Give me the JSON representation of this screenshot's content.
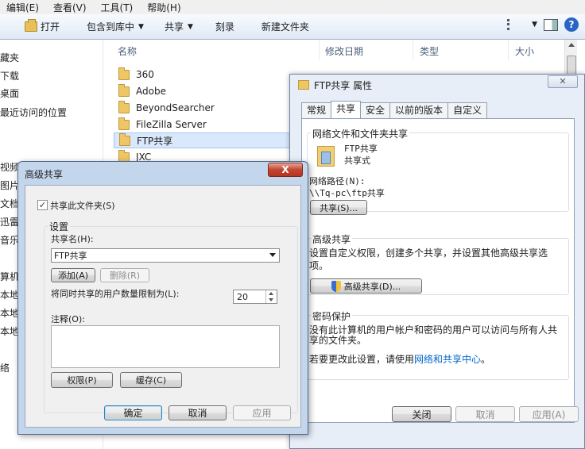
{
  "explorer": {
    "menu": [
      "编辑(E)",
      "查看(V)",
      "工具(T)",
      "帮助(H)"
    ],
    "toolbar": {
      "open": "打开",
      "include_in_library": "包含到库中",
      "share_with": "共享",
      "burn": "刻录",
      "new_folder": "新建文件夹"
    },
    "columns": {
      "name": "名称",
      "modified": "修改日期",
      "type": "类型",
      "size": "大小"
    },
    "nav": [
      "藏夹",
      "下载",
      "桌面",
      "最近访问的位置",
      "视频",
      "图片",
      "文档",
      "迅雷",
      "音乐",
      "算机",
      "本地",
      "本地",
      "本地",
      "络"
    ],
    "files": [
      "360",
      "Adobe",
      "BeyondSearcher",
      "FileZilla Server",
      "FTP共享",
      "JXC"
    ]
  },
  "props": {
    "title": "FTP共享 属性",
    "close": "✕",
    "tabs": [
      "常规",
      "共享",
      "安全",
      "以前的版本",
      "自定义"
    ],
    "net_share": {
      "heading": "网络文件和文件夹共享",
      "name": "FTP共享",
      "state": "共享式",
      "path_label": "网络路径(N):",
      "path": "\\\\Tq-pc\\ftp共享",
      "share_btn": "共享(S)..."
    },
    "adv_share": {
      "heading": "高级共享",
      "desc": "设置自定义权限，创建多个共享，并设置其他高级共享选项。",
      "btn": "高级共享(D)..."
    },
    "password": {
      "heading": "密码保护",
      "desc": "没有此计算机的用户帐户和密码的用户可以访问与所有人共享的文件夹。",
      "change_prefix": "若要更改此设置，请使用",
      "link": "网络和共享中心",
      "suffix": "。"
    },
    "buttons": {
      "close": "关闭",
      "cancel": "取消",
      "apply": "应用(A)"
    }
  },
  "adv": {
    "title": "高级共享",
    "close": "X",
    "share_checkbox_label": "共享此文件夹(S)",
    "share_checked": true,
    "settings_label": "设置",
    "share_name_label": "共享名(H):",
    "share_name_value": "FTP共享",
    "add_btn": "添加(A)",
    "remove_btn": "删除(R)",
    "limit_label": "将同时共享的用户数量限制为(L):",
    "limit_value": "20",
    "comment_label": "注释(O):",
    "permissions_btn": "权限(P)",
    "caching_btn": "缓存(C)",
    "ok_btn": "确定",
    "cancel_btn": "取消",
    "apply_btn": "应用"
  }
}
